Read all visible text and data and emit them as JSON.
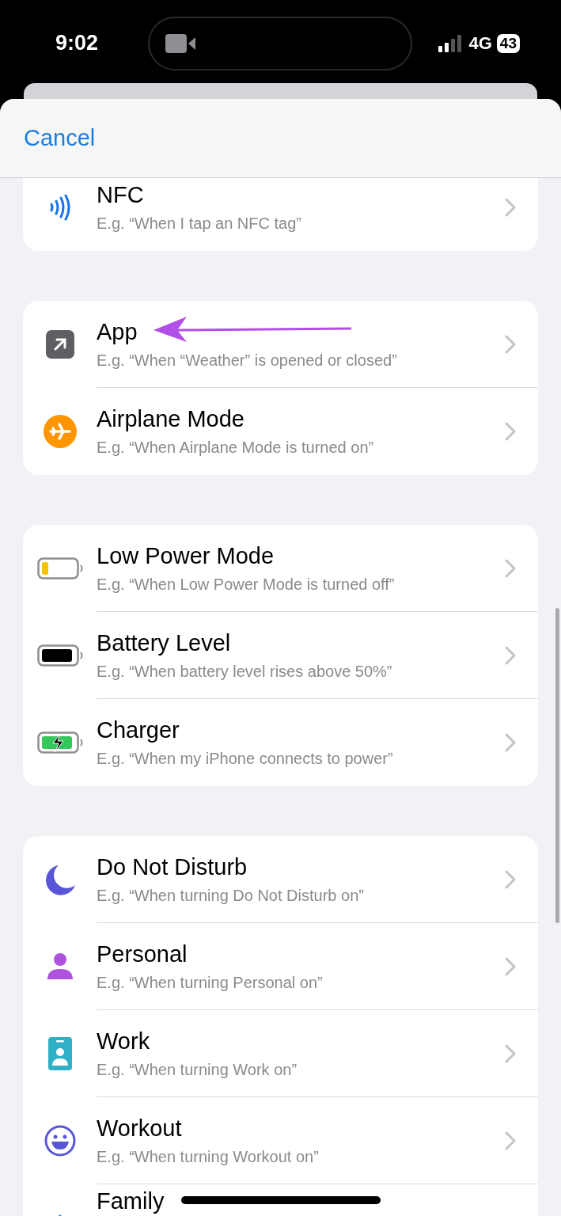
{
  "status_bar": {
    "time": "9:02",
    "network": "4G",
    "battery": "43"
  },
  "header": {
    "cancel": "Cancel"
  },
  "groups": [
    {
      "items": [
        {
          "kind": "nfc",
          "title": "NFC",
          "subtitle": "E.g. “When I tap an NFC tag”"
        }
      ]
    },
    {
      "items": [
        {
          "kind": "app",
          "title": "App",
          "subtitle": "E.g. “When “Weather” is opened or closed”",
          "annotated": true
        },
        {
          "kind": "airplane",
          "title": "Airplane Mode",
          "subtitle": "E.g. “When Airplane Mode is turned on”"
        }
      ]
    },
    {
      "items": [
        {
          "kind": "low-power",
          "title": "Low Power Mode",
          "subtitle": "E.g. “When Low Power Mode is turned off”"
        },
        {
          "kind": "battery",
          "title": "Battery Level",
          "subtitle": "E.g. “When battery level rises above 50%”"
        },
        {
          "kind": "charger",
          "title": "Charger",
          "subtitle": "E.g. “When my iPhone connects to power”"
        }
      ]
    },
    {
      "items": [
        {
          "kind": "moon",
          "title": "Do Not Disturb",
          "subtitle": "E.g. “When turning Do Not Disturb on”"
        },
        {
          "kind": "person",
          "title": "Personal",
          "subtitle": "E.g. “When turning Personal on”"
        },
        {
          "kind": "badge",
          "title": "Work",
          "subtitle": "E.g. “When turning Work on”"
        },
        {
          "kind": "smiley",
          "title": "Workout",
          "subtitle": "E.g. “When turning Workout on”"
        },
        {
          "kind": "house",
          "title": "Family"
        }
      ]
    }
  ]
}
